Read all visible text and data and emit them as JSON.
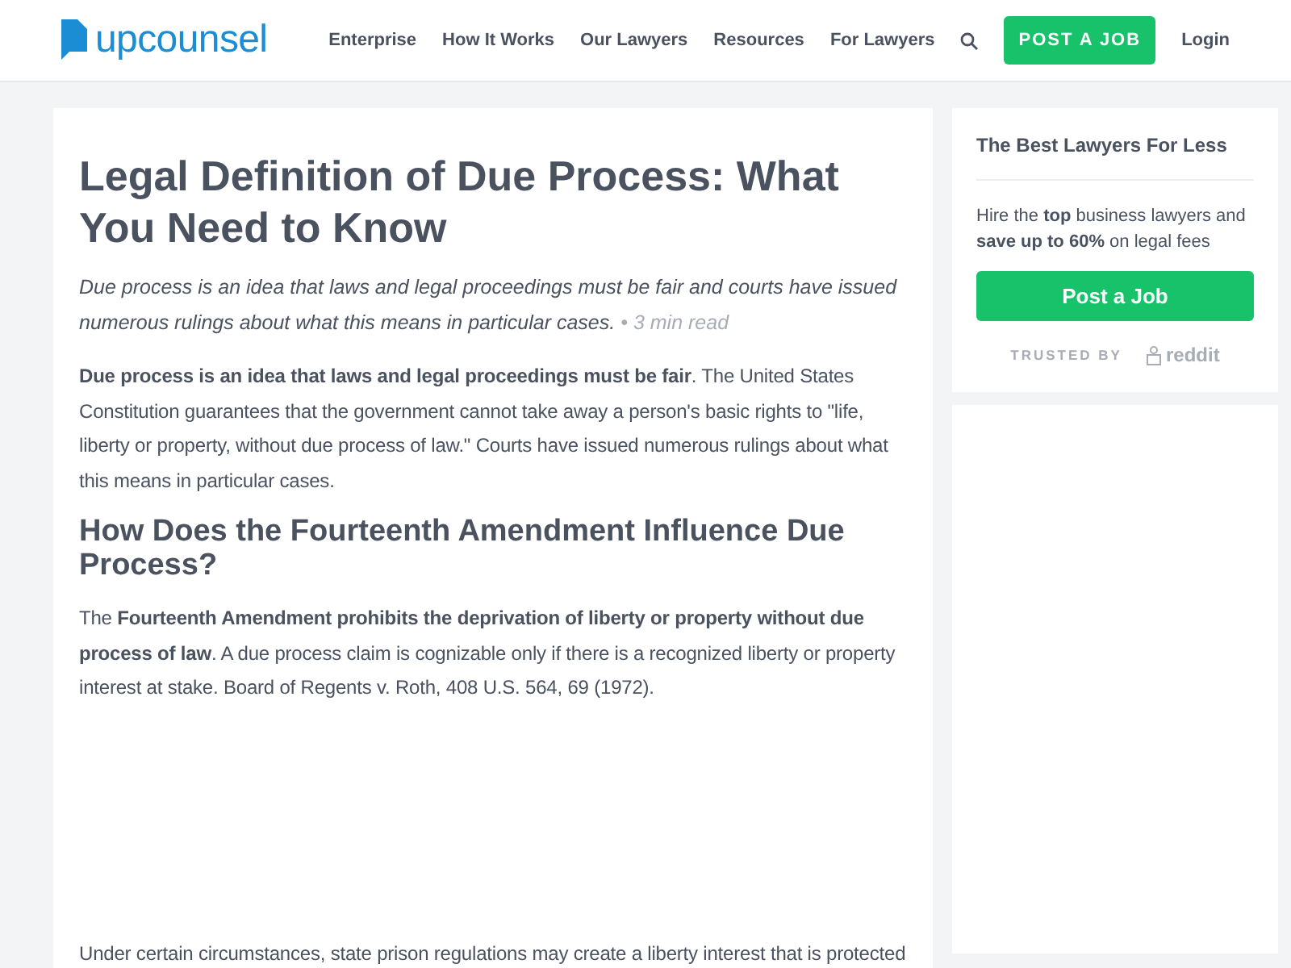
{
  "header": {
    "logo": "upcounsel",
    "nav": [
      "Enterprise",
      "How It Works",
      "Our Lawyers",
      "Resources",
      "For Lawyers"
    ],
    "cta": "POST A JOB",
    "login": "Login"
  },
  "article": {
    "title": "Legal Definition of Due Process: What You Need to Know",
    "summary": "Due process is an idea that laws and legal proceedings must be fair and courts have issued numerous rulings about what this means in particular cases.",
    "read_time": "• 3 min read",
    "paragraphs": [
      "**Due process is an idea that laws and legal proceedings must be fair**. The United States Constitution guarantees that the government cannot take away a person's basic rights to \"life, liberty or property, without due process of law.\" Courts have issued numerous rulings about what this means in particular cases."
    ],
    "heading": "How Does the Fourteenth Amendment Influence Due Process?",
    "paragraphs_2": [
      "The **Fourteenth Amendment prohibits the deprivation of liberty or property without due process of law**. A due process claim is cognizable only if there is a recognized liberty or property interest at stake. Board of Regents v. Roth, 408 U.S. 564, 69 (1972)."
    ],
    "paragraphs_3": [
      "Under certain circumstances, state prison regulations may create a liberty interest that is protected"
    ]
  },
  "sidebar": {
    "title": "The Best Lawyers For Less",
    "text": "Hire the **top** business lawyers and **save up to 60%** on legal fees",
    "button": "Post a Job",
    "trusted": "TRUSTED BY",
    "brand": "reddit"
  }
}
